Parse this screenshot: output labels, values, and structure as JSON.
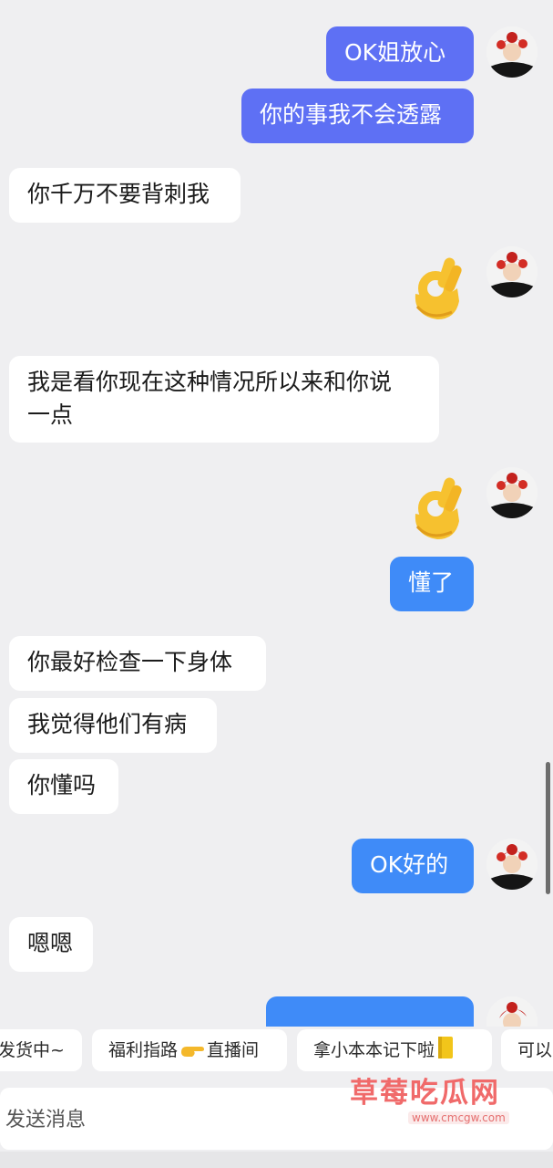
{
  "messages": [
    {
      "side": "out",
      "text": "OK姐放心",
      "color": "#5e70f4"
    },
    {
      "side": "out",
      "text": "你的事我不会透露",
      "color": "#5e70f4"
    },
    {
      "side": "in",
      "text": "你千万不要背刺我"
    },
    {
      "side": "out",
      "emoji": "ok-hand-emoji"
    },
    {
      "side": "in",
      "text": "我是看你现在这种情况所以来和你说\n一点"
    },
    {
      "side": "out",
      "emoji": "ok-hand-emoji"
    },
    {
      "side": "out",
      "text": "懂了",
      "color": "#3f8bf8"
    },
    {
      "side": "in",
      "text": "你最好检查一下身体"
    },
    {
      "side": "in",
      "text": "我觉得他们有病"
    },
    {
      "side": "in",
      "text": "你懂吗"
    },
    {
      "side": "out",
      "text": "OK好的",
      "color": "#3f8bf8"
    },
    {
      "side": "in",
      "text": "嗯嗯"
    }
  ],
  "quick_replies": [
    {
      "text": "发货中~"
    },
    {
      "text_before": "福利指路",
      "icon": "pointing-hand-icon",
      "text_after": "直播间"
    },
    {
      "text_before": "拿小本本记下啦",
      "icon": "notebook-icon"
    },
    {
      "text_before": "可以"
    }
  ],
  "input": {
    "placeholder": "发送消息"
  },
  "watermark": {
    "title": "草莓吃瓜网",
    "url": "www.cmcgw.com"
  }
}
